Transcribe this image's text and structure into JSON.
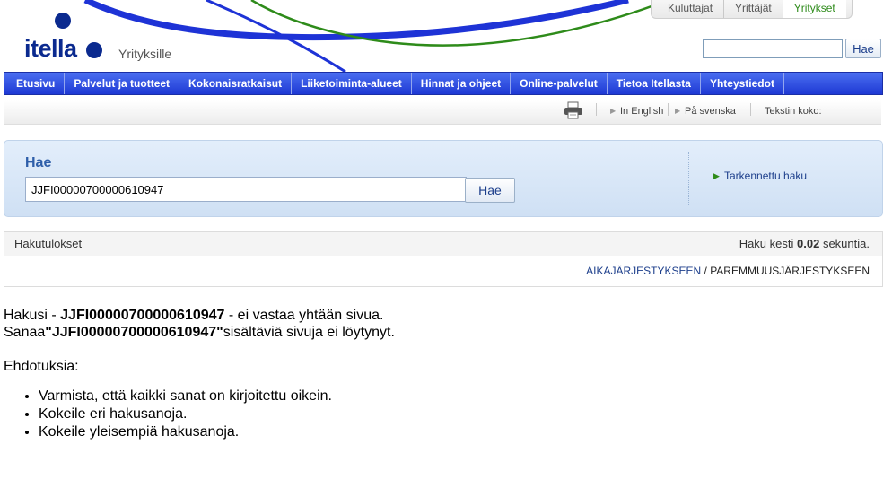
{
  "brand": {
    "logo": "itella",
    "tagline": "Yrityksille",
    "colors": {
      "primary": "#0b2a8f",
      "green": "#2e8b1a"
    }
  },
  "audience_tabs": [
    {
      "label": "Kuluttajat",
      "active": false
    },
    {
      "label": "Yrittäjät",
      "active": false
    },
    {
      "label": "Yritykset",
      "active": true
    }
  ],
  "header_search": {
    "value": "",
    "placeholder": "",
    "button_label": "Hae"
  },
  "nav": {
    "items": [
      "Etusivu",
      "Palvelut ja tuotteet",
      "Kokonaisratkaisut",
      "Liiketoiminta-alueet",
      "Hinnat ja ohjeet",
      "Online-palvelut",
      "Tietoa Itellasta",
      "Yhteystiedot"
    ]
  },
  "utility": {
    "print_icon": "printer-icon",
    "english": "In English",
    "swedish": "På svenska",
    "text_size": "Tekstin koko:"
  },
  "search": {
    "title": "Hae",
    "query": "JJFI00000700000610947",
    "button_label": "Hae",
    "advanced_link": "Tarkennettu haku"
  },
  "results": {
    "title": "Hakutulokset",
    "time_prefix": "Haku kesti",
    "time_value": "0.02",
    "time_suffix": "sekuntia.",
    "sort_by_date": "AIKAJÄRJESTYKSEEN",
    "sort_separator": "/",
    "sort_by_relevance": "PAREMMUUSJÄRJESTYKSEEN"
  },
  "message": {
    "line1_prefix": "Hakusi -",
    "line1_term": "JJFI00000700000610947",
    "line1_suffix": "- ei vastaa yhtään sivua.",
    "line2_prefix": "Sanaa",
    "line2_term": "\"JJFI00000700000610947\"",
    "line2_suffix": "sisältäviä sivuja ei löytynyt.",
    "suggestions_title": "Ehdotuksia:",
    "suggestions": [
      "Varmista, että kaikki sanat on kirjoitettu oikein.",
      "Kokeile eri hakusanoja.",
      "Kokeile yleisempiä hakusanoja."
    ]
  }
}
